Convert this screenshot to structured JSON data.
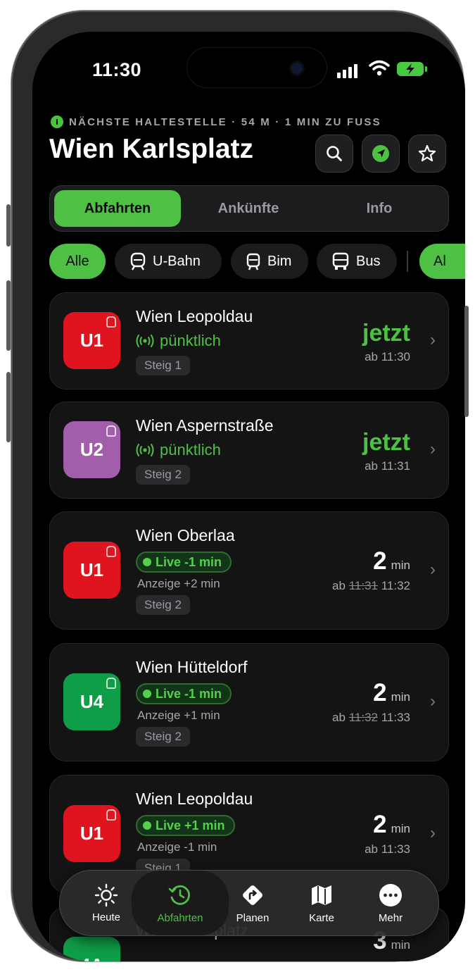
{
  "status": {
    "time": "11:30"
  },
  "header": {
    "nearest_stop": "NÄCHSTE HALTESTELLE · 54 M · 1 MIN ZU FUSS",
    "title": "Wien Karlsplatz",
    "icons": [
      "search-icon",
      "location-arrow-icon",
      "star-icon"
    ]
  },
  "segments": [
    {
      "label": "Abfahrten",
      "active": true
    },
    {
      "label": "Ankünfte",
      "active": false
    },
    {
      "label": "Info",
      "active": false
    }
  ],
  "filters": [
    {
      "label": "Alle",
      "active": true
    },
    {
      "label": "U-Bahn",
      "icon": "train-icon"
    },
    {
      "label": "Bim",
      "icon": "tram-icon"
    },
    {
      "label": "Bus",
      "icon": "bus-icon"
    },
    {
      "label": "Al",
      "active": true
    }
  ],
  "departures": [
    {
      "line": "U1",
      "color": "#e0141e",
      "destination": "Wien Leopoldau",
      "status": "pünktlich",
      "platform": "Steig 1",
      "time_main": "jetzt",
      "time_sub": "ab 11:30"
    },
    {
      "line": "U2",
      "color": "#a25eaa",
      "destination": "Wien Aspernstraße",
      "status": "pünktlich",
      "platform": "Steig 2",
      "time_main": "jetzt",
      "time_sub": "ab 11:31"
    },
    {
      "line": "U1",
      "color": "#e0141e",
      "destination": "Wien Oberlaa",
      "live": "Live -1 min",
      "anzeige": "Anzeige +2 min",
      "platform": "Steig 2",
      "minutes": "2",
      "unit": "min",
      "ab": "ab",
      "sched": "11:31",
      "actual": "11:32"
    },
    {
      "line": "U4",
      "color": "#0f9d48",
      "destination": "Wien Hütteldorf",
      "live": "Live -1 min",
      "anzeige": "Anzeige +1 min",
      "platform": "Steig 2",
      "minutes": "2",
      "unit": "min",
      "ab": "ab",
      "sched": "11:32",
      "actual": "11:33"
    },
    {
      "line": "U1",
      "color": "#e0141e",
      "destination": "Wien Leopoldau",
      "live": "Live +1 min",
      "anzeige": "Anzeige -1 min",
      "platform": "Steig 1",
      "minutes": "2",
      "unit": "min",
      "time_sub": "ab 11:33"
    },
    {
      "line": "4A",
      "color": "#0f9d48",
      "destination": "Wien Karlsplatz",
      "minutes": "3",
      "unit": "min"
    }
  ],
  "tabbar": [
    {
      "label": "Heute",
      "icon": "sun-icon"
    },
    {
      "label": "Abfahrten",
      "icon": "clock-history-icon",
      "active": true
    },
    {
      "label": "Planen",
      "icon": "route-icon"
    },
    {
      "label": "Karte",
      "icon": "map-icon"
    },
    {
      "label": "Mehr",
      "icon": "more-icon"
    }
  ]
}
